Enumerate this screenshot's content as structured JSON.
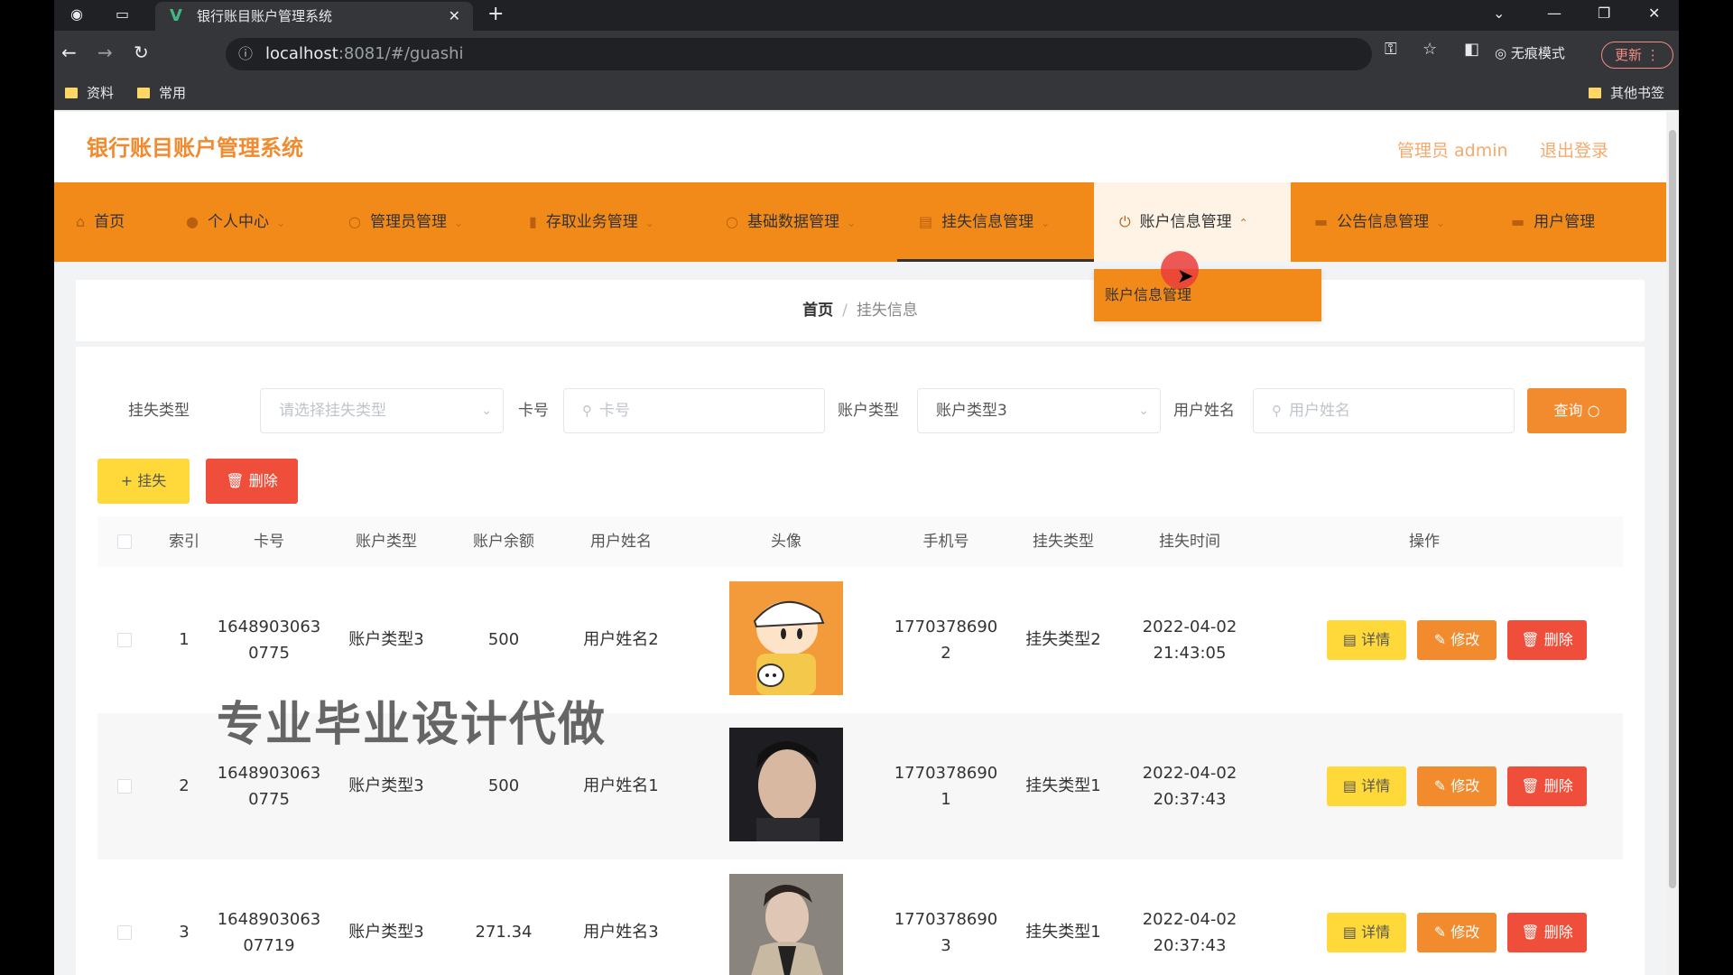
{
  "browser": {
    "tab_title": "银行账目账户管理系统",
    "url_host": "localhost",
    "url_path": ":8081/#/guashi",
    "profile_label": "无痕模式",
    "update_label": "更新",
    "bookmarks": [
      "资料",
      "常用"
    ],
    "other_bookmarks": "其他书签"
  },
  "header": {
    "site_title": "银行账目账户管理系统",
    "admin_label": "管理员 admin",
    "logout_label": "退出登录"
  },
  "menu": {
    "items": [
      {
        "label": "首页"
      },
      {
        "label": "个人中心"
      },
      {
        "label": "管理员管理"
      },
      {
        "label": "存取业务管理"
      },
      {
        "label": "基础数据管理"
      },
      {
        "label": "挂失信息管理"
      },
      {
        "label": "账户信息管理"
      },
      {
        "label": "公告信息管理"
      },
      {
        "label": "用户管理"
      }
    ],
    "submenu_item": "账户信息管理"
  },
  "breadcrumb": {
    "home": "首页",
    "separator": "/",
    "current": "挂失信息"
  },
  "filters": {
    "loss_type_label": "挂失类型",
    "loss_type_placeholder": "请选择挂失类型",
    "card_label": "卡号",
    "card_placeholder": "卡号",
    "account_type_label": "账户类型",
    "account_type_value": "账户类型3",
    "user_name_label": "用户姓名",
    "user_name_placeholder": "用户姓名",
    "query_button": "查询"
  },
  "actions": {
    "add_button": "+ 挂失",
    "delete_button": "删除"
  },
  "table": {
    "columns": [
      "索引",
      "卡号",
      "账户类型",
      "账户余额",
      "用户姓名",
      "头像",
      "手机号",
      "挂失类型",
      "挂失时间",
      "操作"
    ],
    "rows": [
      {
        "index": "1",
        "card_line1": "1648903063",
        "card_line2": "0775",
        "account_type": "账户类型3",
        "balance": "500",
        "user_name": "用户姓名2",
        "phone_line1": "1770378690",
        "phone_line2": "2",
        "loss_type": "挂失类型2",
        "date": "2022-04-02",
        "time": "21:43:05"
      },
      {
        "index": "2",
        "card_line1": "1648903063",
        "card_line2": "0775",
        "account_type": "账户类型3",
        "balance": "500",
        "user_name": "用户姓名1",
        "phone_line1": "1770378690",
        "phone_line2": "1",
        "loss_type": "挂失类型1",
        "date": "2022-04-02",
        "time": "20:37:43"
      },
      {
        "index": "3",
        "card_line1": "1648903063",
        "card_line2": "07719",
        "account_type": "账户类型3",
        "balance": "271.34",
        "user_name": "用户姓名3",
        "phone_line1": "1770378690",
        "phone_line2": "3",
        "loss_type": "挂失类型1",
        "date": "2022-04-02",
        "time": "20:37:43"
      }
    ],
    "row_actions": {
      "detail": "详情",
      "edit": "修改",
      "delete": "删除"
    }
  },
  "watermark": "专业毕业设计代做",
  "colors": {
    "brand": "#f28a1a",
    "danger": "#ef4f3a",
    "warning": "#ffd83a"
  }
}
